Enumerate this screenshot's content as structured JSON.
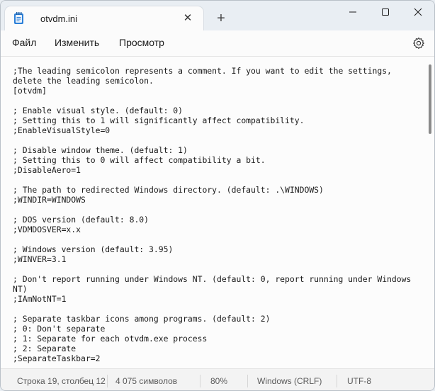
{
  "window": {
    "tab_title": "otvdm.ini",
    "new_tab_icon": "plus-icon",
    "controls": [
      "minimize-icon",
      "maximize-icon",
      "close-icon"
    ]
  },
  "menu": {
    "file": "Файл",
    "edit": "Изменить",
    "view": "Просмотр",
    "settings_icon": "gear-icon"
  },
  "editor": {
    "lines": [
      ";The leading semicolon represents a comment. If you want to edit the settings,",
      "delete the leading semicolon.",
      "[otvdm]",
      "",
      "; Enable visual style. (default: 0)",
      "; Setting this to 1 will significantly affect compatibility.",
      ";EnableVisualStyle=0",
      "",
      "; Disable window theme. (defualt: 1)",
      "; Setting this to 0 will affect compatibility a bit.",
      ";DisableAero=1",
      "",
      "; The path to redirected Windows directory. (default: .\\WINDOWS)",
      ";WINDIR=WINDOWS",
      "",
      "; DOS version (default: 8.0)",
      ";VDMDOSVER=x.x",
      "",
      "; Windows version (default: 3.95)",
      ";WINVER=3.1",
      "",
      "; Don't report running under Windows NT. (default: 0, report running under Windows",
      "NT)",
      ";IAmNotNT=1",
      "",
      "; Separate taskbar icons among programs. (default: 2)",
      "; 0: Don't separate",
      "; 1: Separate for each otvdm.exe process",
      "; 2: Separate",
      ";SeparateTaskbar=2"
    ]
  },
  "status": {
    "position": "Строка 19, столбец 12",
    "chars": "4 075 символов",
    "zoom": "80%",
    "line_endings": "Windows (CRLF)",
    "encoding": "UTF-8"
  }
}
